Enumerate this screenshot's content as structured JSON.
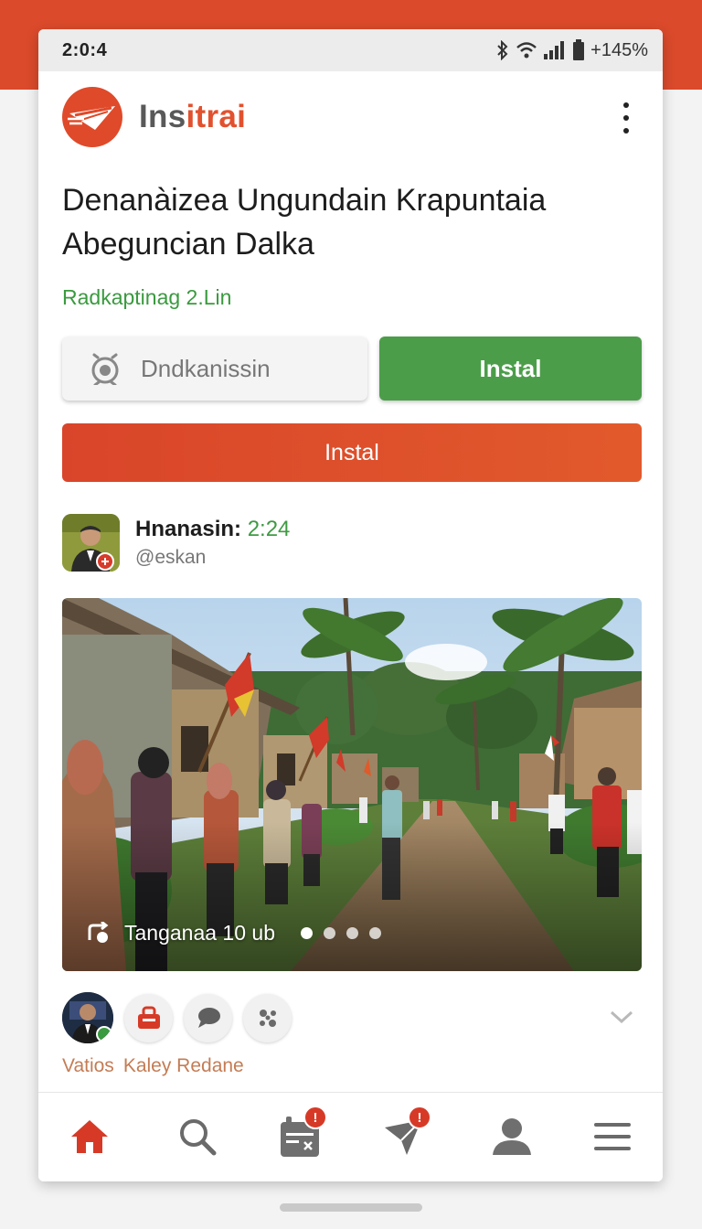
{
  "status_bar": {
    "time": "2:0:4",
    "battery_text": "+145%",
    "icons": [
      "bluetooth-icon",
      "wifi-icon",
      "signal-icon",
      "battery-icon"
    ]
  },
  "app": {
    "name_part1": "Ins",
    "name_part2": "itrai",
    "brand_color": "#e2512e",
    "menu_icon": "kebab-menu-icon"
  },
  "listing": {
    "title": "Denanàizea Ungundain Krapuntaia Abeguncian Dalka",
    "subtitle": "Radkaptinag 2.Lin"
  },
  "actions": {
    "secondary_label": "Dndkanissin",
    "secondary_icon": "camera-icon",
    "install_primary": "Instal",
    "install_secondary": "Instal",
    "green": "#4c9d4a",
    "red": "#dc4b2a"
  },
  "author": {
    "name": "Hnanasin:",
    "time": "2:24",
    "handle": "@eskan"
  },
  "media": {
    "caption": "Tanganaa 10 ub",
    "caption_icon": "repost-icon",
    "page_count": 4,
    "active_page": 1
  },
  "reactions": {
    "icons": [
      "store-icon",
      "comment-icon",
      "share-icon"
    ],
    "footer_left": "Vatios",
    "footer_right": "Kaley Redane"
  },
  "bottom_nav": {
    "items": [
      "home-icon",
      "search-icon",
      "calendar-icon",
      "send-icon",
      "profile-icon",
      "menu-icon"
    ],
    "calendar_badge": "!",
    "send_badge": "!"
  }
}
